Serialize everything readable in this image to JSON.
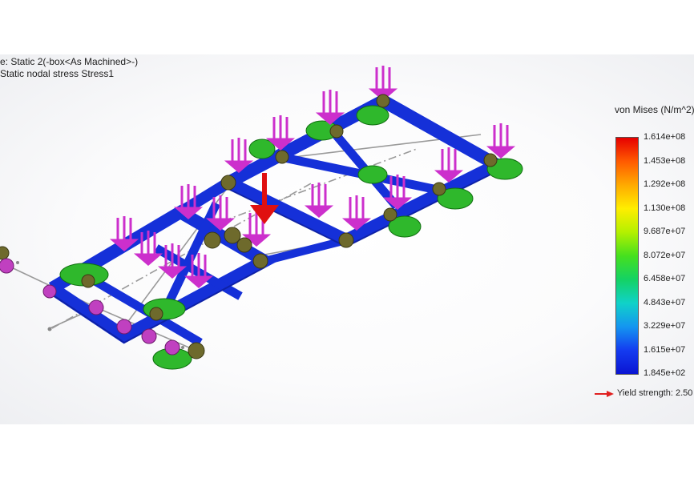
{
  "study": {
    "line1": "e: Static 2(-box<As Machined>-)",
    "line2": "Static nodal stress Stress1"
  },
  "legend": {
    "title": "von Mises (N/m^2)",
    "labels": [
      "1.614e+08",
      "1.453e+08",
      "1.292e+08",
      "1.130e+08",
      "9.687e+07",
      "8.072e+07",
      "6.458e+07",
      "4.843e+07",
      "3.229e+07",
      "1.615e+07",
      "1.845e+02"
    ],
    "yield": "Yield strength: 2.50"
  },
  "colors": {
    "frame_beam": "#1530d8",
    "fixture": "#2fb82c",
    "load_arrow": "#cc2fcc",
    "force_arrow": "#e01010",
    "connector": "#6e6a2c",
    "joint": "#c040c0",
    "yield_marker": "#e02020"
  }
}
